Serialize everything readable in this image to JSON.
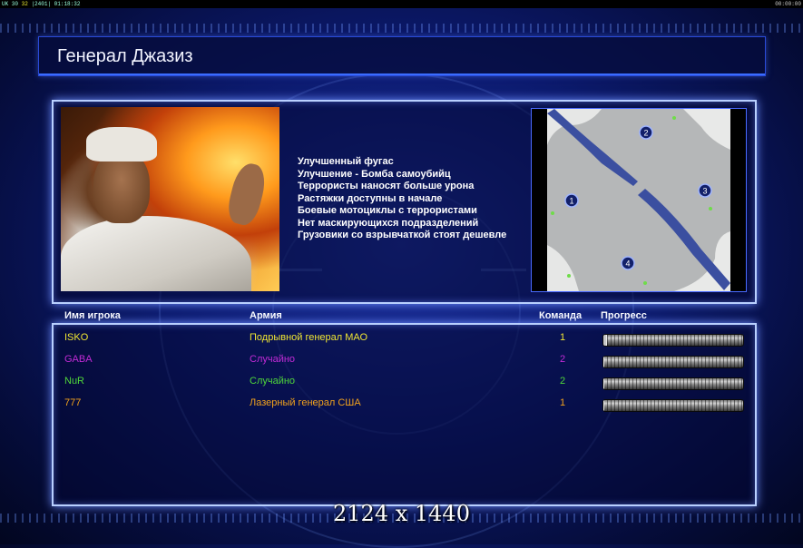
{
  "status_bar": {
    "left_text": "UK 30",
    "left_highlight": "32",
    "left_rest": "|2401| 01:18:32",
    "right_text": "00:00:00"
  },
  "general": {
    "name": "Генерал Джазиз",
    "perks": [
      "Улучшенный фугас",
      "Улучшение - Бомба самоубийц",
      "Террористы наносят больше урона",
      "Растяжки доступны в начале",
      "Боевые мотоциклы с террористами",
      "Нет маскирующихся подразделений",
      "Грузовики со взрывчаткой стоят дешевле"
    ]
  },
  "minimap": {
    "start_positions": [
      "1",
      "2",
      "3",
      "4"
    ]
  },
  "players_table": {
    "headers": {
      "name": "Имя игрока",
      "army": "Армия",
      "team": "Команда",
      "progress": "Прогресс"
    },
    "rows": [
      {
        "name": "ISKO",
        "army": "Подрывной генерал МАО",
        "team": "1",
        "color": "#f0e633",
        "progress": 0.02
      },
      {
        "name": "GABA",
        "army": "Случайно",
        "team": "2",
        "color": "#c22bd6",
        "progress": 0.0
      },
      {
        "name": "NuR",
        "army": "Случайно",
        "team": "2",
        "color": "#4fd63a",
        "progress": 0.0
      },
      {
        "name": "777",
        "army": "Лазерный генерал США",
        "team": "1",
        "color": "#f2a21c",
        "progress": 0.0
      }
    ]
  },
  "watermark": "2124 x 1440"
}
